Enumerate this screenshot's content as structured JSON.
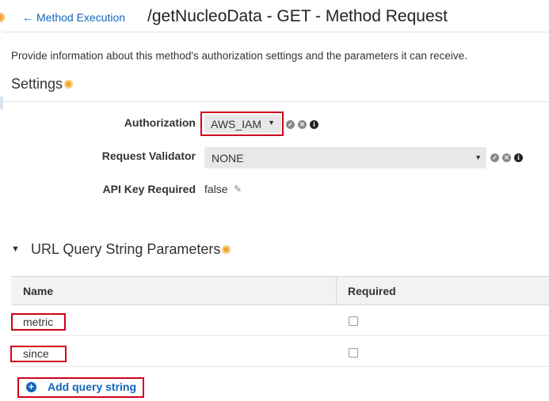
{
  "header": {
    "back_label": "Method Execution",
    "title": "/getNucleoData - GET - Method Request"
  },
  "description": "Provide information about this method's authorization settings and the parameters it can receive.",
  "settings": {
    "title": "Settings",
    "authorization": {
      "label": "Authorization",
      "value": "AWS_IAM"
    },
    "request_validator": {
      "label": "Request Validator",
      "value": "NONE"
    },
    "api_key_required": {
      "label": "API Key Required",
      "value": "false"
    }
  },
  "url_query_params": {
    "title": "URL Query String Parameters",
    "columns": [
      "Name",
      "Required"
    ],
    "rows": [
      {
        "name": "metric",
        "required": false
      },
      {
        "name": "since",
        "required": false
      }
    ],
    "add_label": "Add query string"
  },
  "colors": {
    "highlight": "#d0021b",
    "link": "#1166bb",
    "info_dot": "#f0a030"
  }
}
